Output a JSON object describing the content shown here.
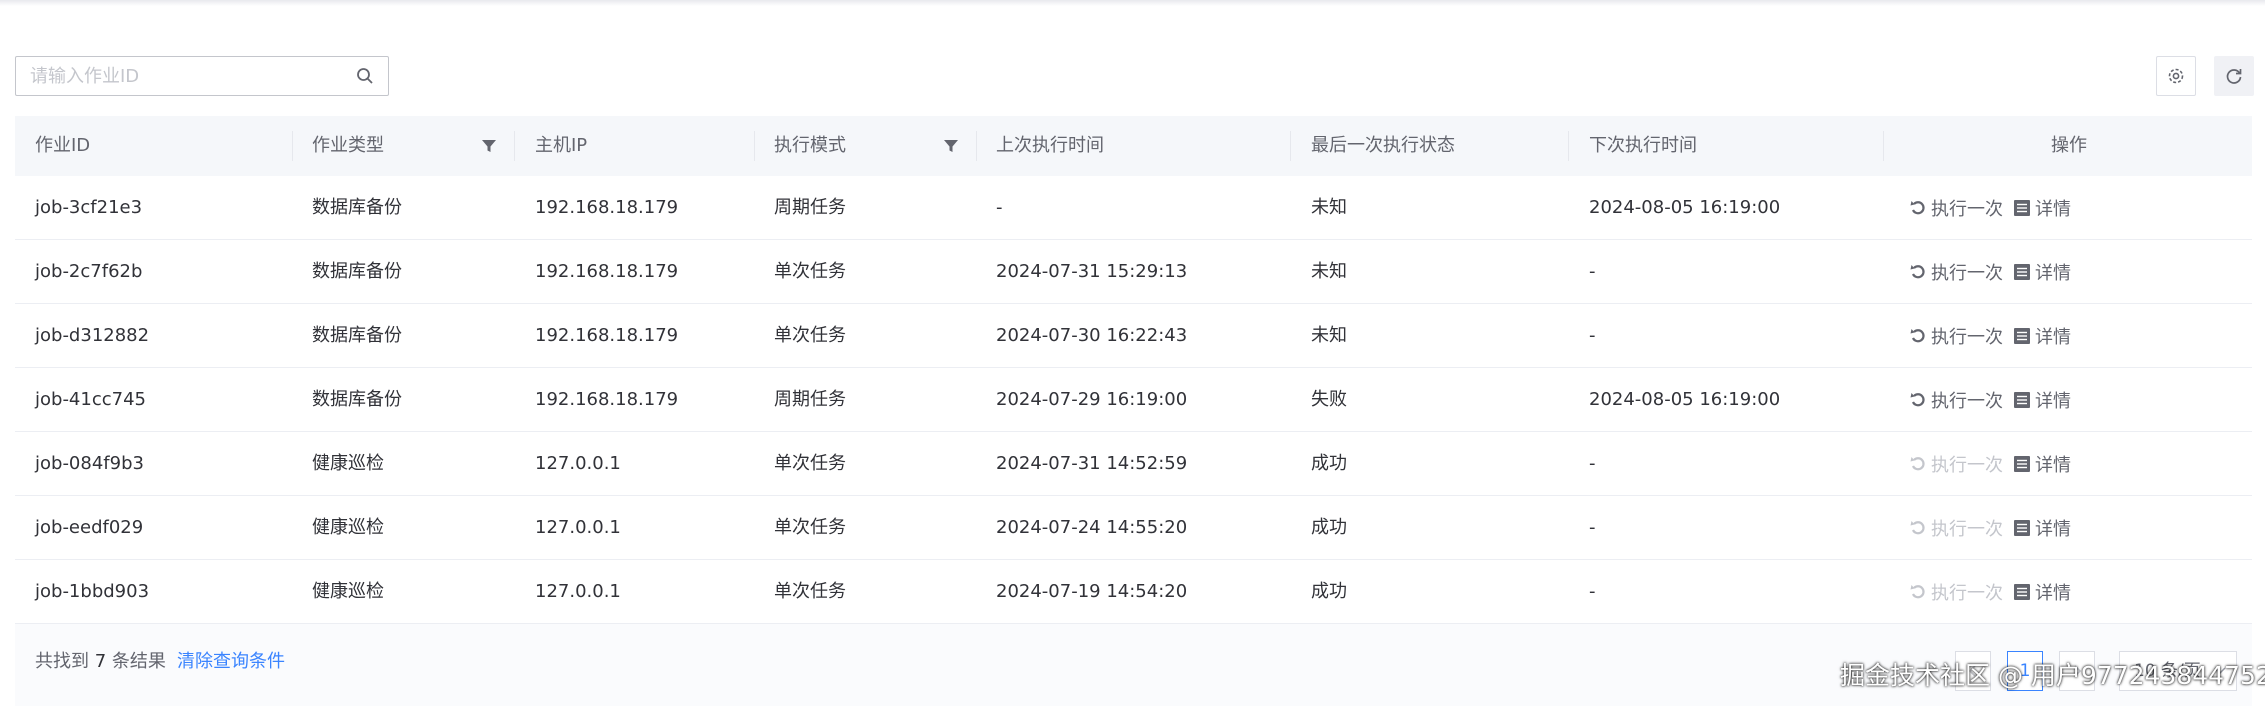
{
  "search": {
    "placeholder": "请输入作业ID",
    "value": ""
  },
  "toolbar": {
    "settings_icon": "gear-icon",
    "refresh_icon": "refresh-icon"
  },
  "table": {
    "columns": [
      "作业ID",
      "作业类型",
      "主机IP",
      "执行模式",
      "上次执行时间",
      "最后一次执行状态",
      "下次执行时间",
      "操作"
    ],
    "filterable_columns": [
      "作业类型",
      "执行模式"
    ],
    "rows": [
      {
        "id": "job-3cf21e3",
        "type": "数据库备份",
        "ip": "192.168.18.179",
        "mode": "周期任务",
        "last": "-",
        "status": "未知",
        "next": "2024-08-05 16:19:00",
        "run_enabled": true
      },
      {
        "id": "job-2c7f62b",
        "type": "数据库备份",
        "ip": "192.168.18.179",
        "mode": "单次任务",
        "last": "2024-07-31 15:29:13",
        "status": "未知",
        "next": "-",
        "run_enabled": true
      },
      {
        "id": "job-d312882",
        "type": "数据库备份",
        "ip": "192.168.18.179",
        "mode": "单次任务",
        "last": "2024-07-30 16:22:43",
        "status": "未知",
        "next": "-",
        "run_enabled": true
      },
      {
        "id": "job-41cc745",
        "type": "数据库备份",
        "ip": "192.168.18.179",
        "mode": "周期任务",
        "last": "2024-07-29 16:19:00",
        "status": "失败",
        "next": "2024-08-05 16:19:00",
        "run_enabled": true
      },
      {
        "id": "job-084f9b3",
        "type": "健康巡检",
        "ip": "127.0.0.1",
        "mode": "单次任务",
        "last": "2024-07-31 14:52:59",
        "status": "成功",
        "next": "-",
        "run_enabled": false
      },
      {
        "id": "job-eedf029",
        "type": "健康巡检",
        "ip": "127.0.0.1",
        "mode": "单次任务",
        "last": "2024-07-24 14:55:20",
        "status": "成功",
        "next": "-",
        "run_enabled": false
      },
      {
        "id": "job-1bbd903",
        "type": "健康巡检",
        "ip": "127.0.0.1",
        "mode": "单次任务",
        "last": "2024-07-19 14:54:20",
        "status": "成功",
        "next": "-",
        "run_enabled": false
      }
    ],
    "actions": {
      "run_once": "执行一次",
      "detail": "详情"
    }
  },
  "footer": {
    "prefix": "共找到",
    "count": "7",
    "suffix": "条结果",
    "clear_label": "清除查询条件",
    "current_page": "1",
    "page_size_label": "10 条/页"
  },
  "watermark": "掘金技术社区 @ 用户977243844752",
  "colors": {
    "accent": "#3a84ff",
    "header_bg": "#f5f7fa",
    "text": "#313238",
    "muted": "#63656e",
    "disabled": "#c4c6cc"
  }
}
